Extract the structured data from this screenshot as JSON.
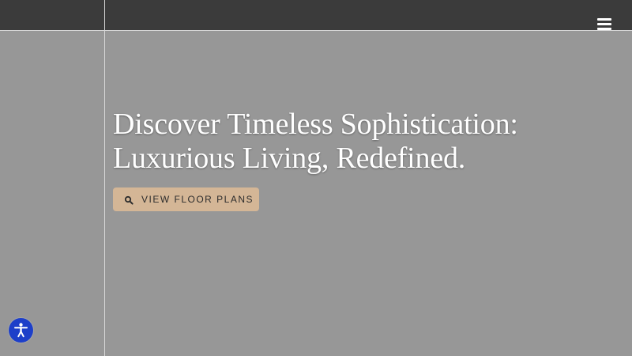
{
  "header": {
    "menu_icon": "hamburger-menu-icon"
  },
  "hero": {
    "title_line_1": "Discover Timeless Sophistication:",
    "title_line_2": "Luxurious Living, Redefined.",
    "cta": {
      "label": "VIEW FLOOR PLANS",
      "icon": "search-icon"
    }
  },
  "accessibility": {
    "icon": "accessibility-person-icon",
    "color": "#1d3fc9"
  },
  "colors": {
    "background": "#979797",
    "topbar": "#3b3b3b",
    "cta_background": "#d4b696",
    "title_text": "#ffffff"
  }
}
